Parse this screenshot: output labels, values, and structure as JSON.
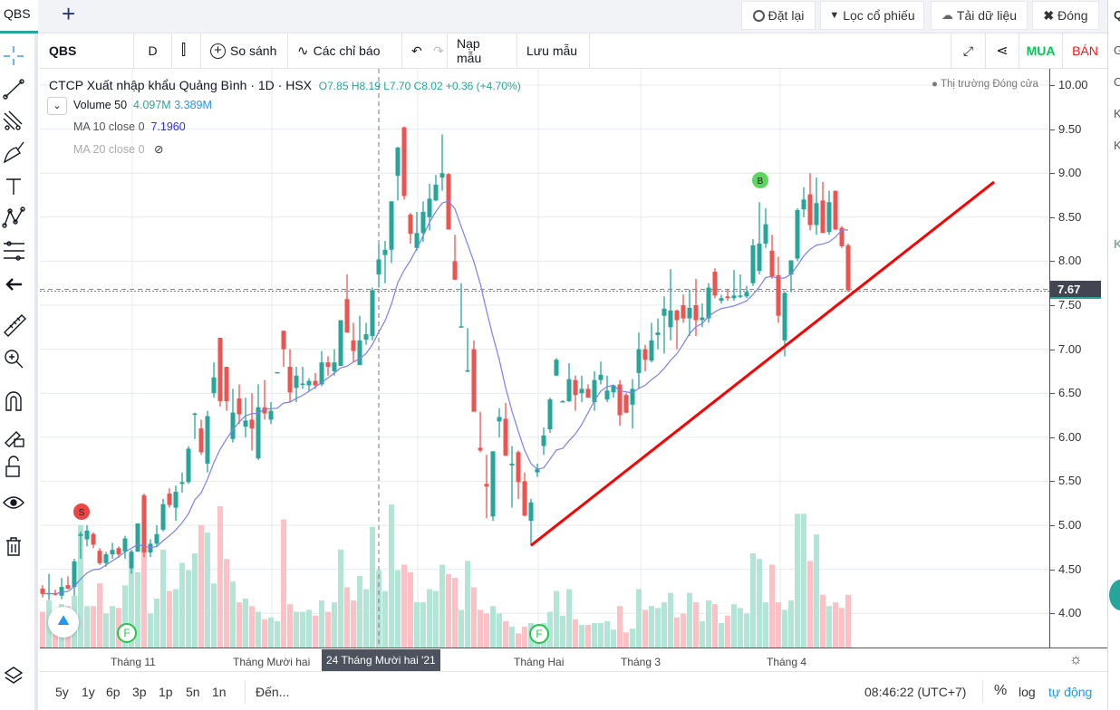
{
  "tab": {
    "label": "QBS",
    "add_icon": "plus-icon"
  },
  "top_buttons": [
    {
      "label": "Đặt lại",
      "icon": "reset-icon"
    },
    {
      "label": "Lọc cổ phiếu",
      "icon": "filter-icon"
    },
    {
      "label": "Tải dữ liệu",
      "icon": "cloud-download-icon"
    },
    {
      "label": "Đóng",
      "icon": "close-icon"
    }
  ],
  "toolbar": {
    "symbol": "QBS",
    "interval": "D",
    "compare": "So sánh",
    "indicators": "Các chỉ báo",
    "load_template": "Nạp mẫu",
    "save_template": "Lưu mẫu",
    "buy": "MUA",
    "sell": "BÁN"
  },
  "legend": {
    "title": "CTCP Xuất nhập khẩu Quảng Bình · 1D · HSX",
    "o": "O7.85",
    "h": "H8.19",
    "l": "L7.70",
    "c": "C8.02",
    "change": "+0.36 (+4.70%)",
    "volume_label": "Volume 50",
    "volume_value": "4.097M",
    "volume_ma": "3.389M",
    "ma10_label": "MA 10 close 0",
    "ma10_value": "7.1960",
    "ma20_label": "MA 20 close 0",
    "market_status": "Thị trường Đóng cửa"
  },
  "colors": {
    "up": "#26a69a",
    "down": "#ef5350",
    "up_vol": "#b2e5d6",
    "down_vol": "#fcc0c5",
    "ma10": "#7b7ff0",
    "trend": "#ff0000",
    "buy": "#00c853",
    "sell": "#ff1010"
  },
  "chart_data": {
    "type": "candlestick",
    "ylim": [
      3.7,
      10.2
    ],
    "price_ticks": [
      "10.00",
      "9.50",
      "9.00",
      "8.50",
      "8.00",
      "7.50",
      "7.00",
      "6.50",
      "6.00",
      "5.50",
      "5.00",
      "4.50",
      "4.00"
    ],
    "last_price": "7.67",
    "time_labels": [
      "Tháng 11",
      "Tháng Mười hai",
      "Tháng Hai",
      "Tháng 3",
      "Tháng 4"
    ],
    "crosshair_label": "24 Tháng Mười hai '21",
    "markers": {
      "sell": "S",
      "buy": "B",
      "f1": "F",
      "f2": "F"
    },
    "ma_period": 10,
    "trendline": {
      "from": [
        77,
        4.77
      ],
      "to": [
        150,
        8.9
      ]
    },
    "candles": [
      [
        4.28,
        4.32,
        4.18,
        4.22,
        1.9
      ],
      [
        4.22,
        4.45,
        4.15,
        4.23,
        2.5
      ],
      [
        4.23,
        4.27,
        4.2,
        4.21,
        0.9
      ],
      [
        4.2,
        4.4,
        4.16,
        4.3,
        2.3
      ],
      [
        4.32,
        4.42,
        4.27,
        4.28,
        2.2
      ],
      [
        4.3,
        4.62,
        4.2,
        4.59,
        2.75
      ],
      [
        4.88,
        4.93,
        4.62,
        4.9,
        6.5
      ],
      [
        4.84,
        5.0,
        4.76,
        4.94,
        2.2
      ],
      [
        4.9,
        4.92,
        4.74,
        4.78,
        2.2
      ],
      [
        4.71,
        4.74,
        4.55,
        4.57,
        3.4
      ],
      [
        4.57,
        4.7,
        4.53,
        4.67,
        1.8
      ],
      [
        4.67,
        4.8,
        4.62,
        4.72,
        2.2
      ],
      [
        4.74,
        4.76,
        4.63,
        4.67,
        2.1
      ],
      [
        4.7,
        4.88,
        4.62,
        4.85,
        3.3
      ],
      [
        4.51,
        4.72,
        4.45,
        4.7,
        4.2
      ],
      [
        4.7,
        5.02,
        4.7,
        5.02,
        4.0
      ],
      [
        5.34,
        5.36,
        4.64,
        4.69,
        5.3
      ],
      [
        4.69,
        4.84,
        4.64,
        4.79,
        1.8
      ],
      [
        4.79,
        5.0,
        4.75,
        4.9,
        2.6
      ],
      [
        4.95,
        5.3,
        4.93,
        5.24,
        5.2
      ],
      [
        5.36,
        5.42,
        5.2,
        5.23,
        3.0
      ],
      [
        5.2,
        5.45,
        5.05,
        5.38,
        3.1
      ],
      [
        5.47,
        5.6,
        5.37,
        5.49,
        4.5
      ],
      [
        5.49,
        5.9,
        5.47,
        5.87,
        4.1
      ],
      [
        6.26,
        6.28,
        5.98,
        6.27,
        5.0
      ],
      [
        6.1,
        6.2,
        5.8,
        5.83,
        6.5
      ],
      [
        5.7,
        6.3,
        5.6,
        6.24,
        6.1
      ],
      [
        6.5,
        6.85,
        6.45,
        6.68,
        3.4
      ],
      [
        7.13,
        7.13,
        6.35,
        6.41,
        7.5
      ],
      [
        6.8,
        6.8,
        6.3,
        6.41,
        4.7
      ],
      [
        5.98,
        6.55,
        5.94,
        6.28,
        3.5
      ],
      [
        6.44,
        6.6,
        6.15,
        6.26,
        2.4
      ],
      [
        6.12,
        6.45,
        6.0,
        6.19,
        2.6
      ],
      [
        6.2,
        6.5,
        5.85,
        6.1,
        2.2
      ],
      [
        5.76,
        6.6,
        5.74,
        6.34,
        1.9
      ],
      [
        6.34,
        6.65,
        6.2,
        6.27,
        1.5
      ],
      [
        6.2,
        6.4,
        6.15,
        6.3,
        1.6
      ],
      [
        6.74,
        6.74,
        6.74,
        6.74,
        1.4
      ],
      [
        7.21,
        7.21,
        6.8,
        7.0,
        6.8
      ],
      [
        6.8,
        7.0,
        6.4,
        6.51,
        2.3
      ],
      [
        6.56,
        6.8,
        6.4,
        6.7,
        1.9
      ],
      [
        6.6,
        6.8,
        6.55,
        6.61,
        1.9
      ],
      [
        6.59,
        6.67,
        6.52,
        6.64,
        2.0
      ],
      [
        6.64,
        6.73,
        6.55,
        6.59,
        1.7
      ],
      [
        6.6,
        6.98,
        6.58,
        6.85,
        2.5
      ],
      [
        6.85,
        6.92,
        6.7,
        6.8,
        1.9
      ],
      [
        6.75,
        7.0,
        6.7,
        6.85,
        2.4
      ],
      [
        6.81,
        7.33,
        6.81,
        7.33,
        5.2
      ],
      [
        7.57,
        7.85,
        7.19,
        7.19,
        3.2
      ],
      [
        7.1,
        7.3,
        6.85,
        6.98,
        2.5
      ],
      [
        6.82,
        7.38,
        6.82,
        7.1,
        3.8
      ],
      [
        7.11,
        7.3,
        7.05,
        7.17,
        3.1
      ],
      [
        7.15,
        7.7,
        7.1,
        7.67,
        6.4
      ],
      [
        7.85,
        8.19,
        7.7,
        8.02,
        4.097
      ],
      [
        8.07,
        8.23,
        7.75,
        8.13,
        3.0
      ],
      [
        8.13,
        8.68,
        7.98,
        8.68,
        7.6
      ],
      [
        8.97,
        9.3,
        8.69,
        9.29,
        4.1
      ],
      [
        9.52,
        9.53,
        8.7,
        8.74,
        4.4
      ],
      [
        8.53,
        8.55,
        8.2,
        8.31,
        4.0
      ],
      [
        8.15,
        8.56,
        8.12,
        8.32,
        2.4
      ],
      [
        8.32,
        8.68,
        8.22,
        8.56,
        2.4
      ],
      [
        8.5,
        8.88,
        8.35,
        8.71,
        3.1
      ],
      [
        8.69,
        8.98,
        8.68,
        8.87,
        3.0
      ],
      [
        8.95,
        9.44,
        8.8,
        9.0,
        4.4
      ],
      [
        8.99,
        9.0,
        8.36,
        8.36,
        3.9
      ],
      [
        8.0,
        8.3,
        7.79,
        7.79,
        3.7
      ],
      [
        7.25,
        7.75,
        7.25,
        7.26,
        2.0
      ],
      [
        6.75,
        7.24,
        6.74,
        6.76,
        4.6
      ],
      [
        7.0,
        7.1,
        6.29,
        6.29,
        3.2
      ],
      [
        5.88,
        6.29,
        5.83,
        5.85,
        2.0
      ],
      [
        5.47,
        5.8,
        5.08,
        5.44,
        1.8
      ],
      [
        5.1,
        5.84,
        5.05,
        5.84,
        2.2
      ],
      [
        6.18,
        6.33,
        6.0,
        6.23,
        1.8
      ],
      [
        6.21,
        6.39,
        5.79,
        5.79,
        1.4
      ],
      [
        5.68,
        5.9,
        5.2,
        5.7,
        1.1
      ],
      [
        5.83,
        5.85,
        5.3,
        5.49,
        0.75
      ],
      [
        5.5,
        5.6,
        5.1,
        5.11,
        1.1
      ],
      [
        5.05,
        5.3,
        4.77,
        5.26,
        1.3
      ],
      [
        5.6,
        5.7,
        5.55,
        5.64,
        0.5
      ],
      [
        5.9,
        6.11,
        5.8,
        6.02,
        1.3
      ],
      [
        6.09,
        6.45,
        6.05,
        6.43,
        1.9
      ],
      [
        6.7,
        6.9,
        6.7,
        6.88,
        3.0
      ],
      [
        6.41,
        6.42,
        6.4,
        6.41,
        1.7
      ],
      [
        6.41,
        6.84,
        6.4,
        6.66,
        3.1
      ],
      [
        6.65,
        6.7,
        6.3,
        6.48,
        1.5
      ],
      [
        6.5,
        6.7,
        6.4,
        6.55,
        1.2
      ],
      [
        6.55,
        6.6,
        6.45,
        6.45,
        1.2
      ],
      [
        6.4,
        6.75,
        6.3,
        6.65,
        1.3
      ],
      [
        6.65,
        6.86,
        6.6,
        6.71,
        1.3
      ],
      [
        6.43,
        6.7,
        6.4,
        6.53,
        1.4
      ],
      [
        6.51,
        6.6,
        6.45,
        6.59,
        0.95
      ],
      [
        6.6,
        6.65,
        6.13,
        6.25,
        2.2
      ],
      [
        6.48,
        6.5,
        6.27,
        6.28,
        0.8
      ],
      [
        6.37,
        6.66,
        6.1,
        6.55,
        1.0
      ],
      [
        6.73,
        7.19,
        6.55,
        7.0,
        3.1
      ],
      [
        7.0,
        7.05,
        6.75,
        6.88,
        2.0
      ],
      [
        6.87,
        7.3,
        6.85,
        7.1,
        2.2
      ],
      [
        7.16,
        7.35,
        7.0,
        7.19,
        2.1
      ],
      [
        7.38,
        7.6,
        6.95,
        7.46,
        2.4
      ],
      [
        7.25,
        7.91,
        7.1,
        7.44,
        2.9
      ],
      [
        7.44,
        7.45,
        7.0,
        7.33,
        1.6
      ],
      [
        7.5,
        7.62,
        7.3,
        7.35,
        1.8
      ],
      [
        7.35,
        7.68,
        7.15,
        7.47,
        2.9
      ],
      [
        7.5,
        7.8,
        7.15,
        7.33,
        2.4
      ],
      [
        7.33,
        7.52,
        7.25,
        7.36,
        1.4
      ],
      [
        7.35,
        7.75,
        7.3,
        7.7,
        2.5
      ],
      [
        7.88,
        7.92,
        7.58,
        7.61,
        2.3
      ],
      [
        7.55,
        7.62,
        7.52,
        7.58,
        1.3
      ],
      [
        7.6,
        7.68,
        7.55,
        7.58,
        1.7
      ],
      [
        7.58,
        7.9,
        7.55,
        7.61,
        2.3
      ],
      [
        7.6,
        7.85,
        7.58,
        7.61,
        2.1
      ],
      [
        7.6,
        7.72,
        7.58,
        7.65,
        1.8
      ],
      [
        7.75,
        8.25,
        7.72,
        8.18,
        5.0
      ],
      [
        7.89,
        8.67,
        7.85,
        8.2,
        4.7
      ],
      [
        8.2,
        8.6,
        8.15,
        8.42,
        2.4
      ],
      [
        8.12,
        8.3,
        7.8,
        7.83,
        4.4
      ],
      [
        7.84,
        8.05,
        7.3,
        7.38,
        2.4
      ],
      [
        7.1,
        7.65,
        6.92,
        7.64,
        2.0
      ],
      [
        7.85,
        8.0,
        7.65,
        8.01,
        2.5
      ],
      [
        8.03,
        8.6,
        8.0,
        8.58,
        7.1
      ],
      [
        8.59,
        8.84,
        8.5,
        8.7,
        7.1
      ],
      [
        8.76,
        9.0,
        8.35,
        8.41,
        4.6
      ],
      [
        8.41,
        8.95,
        8.3,
        8.66,
        6.0
      ],
      [
        8.69,
        8.9,
        8.35,
        8.32,
        2.8
      ],
      [
        8.33,
        8.8,
        8.3,
        8.67,
        2.2
      ],
      [
        8.8,
        8.8,
        8.35,
        8.36,
        2.4
      ],
      [
        8.38,
        8.4,
        8.15,
        8.17,
        2.1
      ],
      [
        8.18,
        8.2,
        7.65,
        7.67,
        2.8
      ]
    ]
  },
  "range_buttons": [
    "5y",
    "1y",
    "6p",
    "3p",
    "1p",
    "5n",
    "1n"
  ],
  "goto": "Đến...",
  "clock": "08:46:22 (UTC+7)",
  "scale": {
    "percent": "%",
    "log": "log",
    "auto": "tự động"
  },
  "right_panel": [
    "Q",
    "G",
    "C",
    "K",
    "K",
    "K"
  ]
}
